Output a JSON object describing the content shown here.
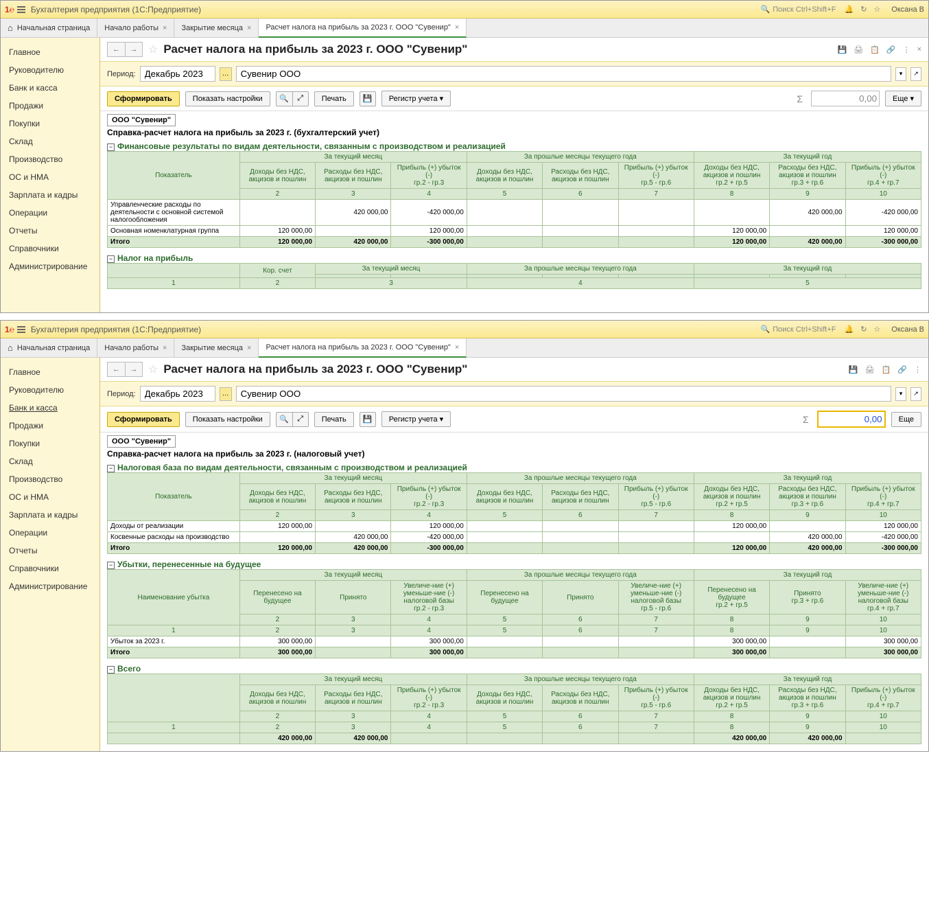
{
  "app": {
    "title": "Бухгалтерия предприятия  (1С:Предприятие)",
    "search_ph": "Поиск Ctrl+Shift+F",
    "user": "Оксана В"
  },
  "tabs": {
    "home": "Начальная страница",
    "t1": "Начало работы",
    "t2": "Закрытие месяца",
    "t3": "Расчет налога на прибыль за 2023 г. ООО \"Сувенир\""
  },
  "sidebar": [
    "Главное",
    "Руководителю",
    "Банк и касса",
    "Продажи",
    "Покупки",
    "Склад",
    "Производство",
    "ОС и НМА",
    "Зарплата и кадры",
    "Операции",
    "Отчеты",
    "Справочники",
    "Администрирование"
  ],
  "page": {
    "title": "Расчет налога на прибыль за 2023 г. ООО \"Сувенир\"",
    "period_lbl": "Период:",
    "period_val": "Декабрь 2023",
    "org": "Сувенир ООО",
    "form": "Сформировать",
    "show": "Показать настройки",
    "print": "Печать",
    "reg": "Регистр учета",
    "more": "Еще",
    "sum1": "0,00",
    "sum2": "0,00"
  },
  "r1": {
    "org": "ООО \"Сувенир\"",
    "title": "Справка-расчет налога на прибыль за 2023 г. (бухгалтерский учет)",
    "sec1": "Финансовые результаты по видам деятельности, связанным с производством и реализацией",
    "sec2": "Налог на прибыль",
    "hdr": {
      "ind": "Показатель",
      "m": "За текущий месяц",
      "pm": "За прошлые месяцы текущего года",
      "y": "За текущий год",
      "kor": "Кор. счет",
      "inc": "Доходы без НДС, акцизов и пошлин",
      "exp": "Расходы без НДС, акцизов и пошлин",
      "pr": "Прибыль (+) убыток (-)",
      "g23": "гр.2 - гр.3",
      "g56": "гр.5 - гр.6",
      "g25": "гр.2 + гр.5",
      "g36": "гр.3 + гр.6",
      "g47": "гр.4 + гр.7"
    },
    "row1": {
      "lbl": "Управленческие расходы по деятельности с основной системой налогообложения",
      "e": "420 000,00",
      "p": "-420 000,00",
      "ye": "420 000,00",
      "yp": "-420 000,00"
    },
    "row2": {
      "lbl": "Основная номенклатурная группа",
      "i": "120 000,00",
      "p": "120 000,00",
      "yi": "120 000,00",
      "yp": "120 000,00"
    },
    "tot": {
      "lbl": "Итого",
      "i": "120 000,00",
      "e": "420 000,00",
      "p": "-300 000,00",
      "yi": "120 000,00",
      "ye": "420 000,00",
      "yp": "-300 000,00"
    },
    "n": {
      "c1": "1",
      "c2": "2",
      "c3": "3",
      "c4": "4",
      "c5": "5",
      "c6": "6",
      "c7": "7",
      "c8": "8",
      "c9": "9",
      "c10": "10"
    }
  },
  "r2": {
    "org": "ООО \"Сувенир\"",
    "title": "Справка-расчет налога на прибыль за 2023 г. (налоговый учет)",
    "sec1": "Налоговая база по видам деятельности, связанным с производством и реализацией",
    "sec2": "Убытки, перенесенные на будущее",
    "sec3": "Всего",
    "hdr": {
      "ind": "Показатель",
      "name": "Наименование убытка",
      "m": "За текущий месяц",
      "pm": "За прошлые месяцы текущего года",
      "y": "За текущий год",
      "inc": "Доходы без НДС, акцизов и пошлин",
      "exp": "Расходы без НДС, акцизов и пошлин",
      "pr": "Прибыль (+) убыток (-)",
      "per": "Перенесено на будущее",
      "pri": "Принято",
      "dec": "Увеличе-ние (+) уменьше-ние (-) налоговой базы",
      "g23": "гр.2 - гр.3",
      "g56": "гр.5 - гр.6",
      "g25": "гр.2 + гр.5",
      "g36": "гр.3 + гр.6",
      "g47": "гр.4 + гр.7"
    },
    "row1": {
      "lbl": "Доходы от реализации",
      "i": "120 000,00",
      "p": "120 000,00",
      "yi": "120 000,00",
      "yp": "120 000,00"
    },
    "row2": {
      "lbl": "Косвенные расходы на производство",
      "e": "420 000,00",
      "p": "-420 000,00",
      "ye": "420 000,00",
      "yp": "-420 000,00"
    },
    "tot": {
      "lbl": "Итого",
      "i": "120 000,00",
      "e": "420 000,00",
      "p": "-300 000,00",
      "yi": "120 000,00",
      "ye": "420 000,00",
      "yp": "-300 000,00"
    },
    "loss": {
      "lbl": "Убыток за 2023 г.",
      "v": "300 000,00"
    },
    "losstot": {
      "lbl": "Итого",
      "v": "300 000,00"
    },
    "all": {
      "i": "420 000,00",
      "e": "420 000,00",
      "yi": "420 000,00",
      "ye": "420 000,00"
    },
    "n": {
      "c1": "1",
      "c2": "2",
      "c3": "3",
      "c4": "4",
      "c5": "5",
      "c6": "6",
      "c7": "7",
      "c8": "8",
      "c9": "9",
      "c10": "10"
    }
  }
}
